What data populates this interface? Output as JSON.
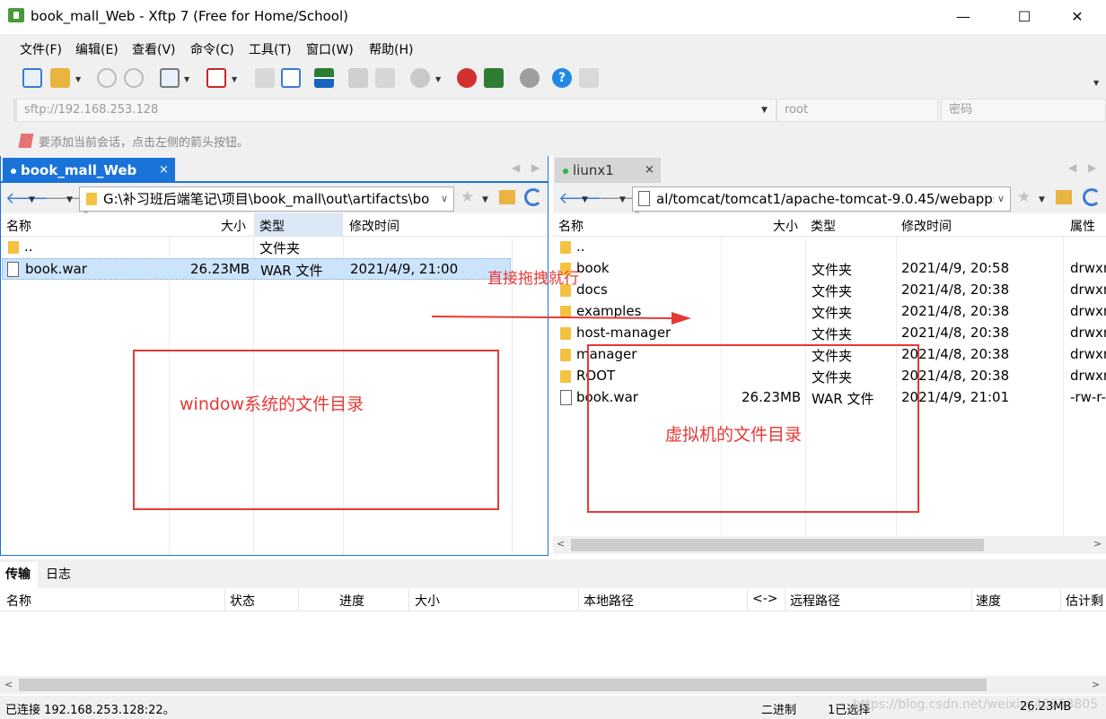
{
  "window": {
    "title": "book_mall_Web - Xftp 7 (Free for Home/School)",
    "minimize": "—",
    "maximize": "☐",
    "close": "✕"
  },
  "menu": [
    "文件(F)",
    "编辑(E)",
    "查看(V)",
    "命令(C)",
    "工具(T)",
    "窗口(W)",
    "帮助(H)"
  ],
  "address": {
    "host": "sftp://192.168.253.128",
    "user": "root",
    "password_placeholder": "密码"
  },
  "hint": "要添加当前会话，点击左侧的箭头按钮。",
  "left_pane": {
    "tab": "book_mall_Web",
    "tab_close": "×",
    "path": "G:\\补习班后端笔记\\项目\\book_mall\\out\\artifacts\\bo",
    "columns": [
      "名称",
      "大小",
      "类型",
      "修改时间"
    ],
    "rows": [
      {
        "name": "..",
        "size": "",
        "type": "文件夹",
        "modified": "",
        "icon": "folder"
      },
      {
        "name": "book.war",
        "size": "26.23MB",
        "type": "WAR 文件",
        "modified": "2021/4/9, 21:00",
        "icon": "file",
        "selected": true
      }
    ]
  },
  "right_pane": {
    "tab": "liunx1",
    "tab_close": "×",
    "path": "al/tomcat/tomcat1/apache-tomcat-9.0.45/webapps",
    "columns": [
      "名称",
      "大小",
      "类型",
      "修改时间",
      "属性"
    ],
    "rows": [
      {
        "name": "..",
        "size": "",
        "type": "",
        "modified": "",
        "attr": "",
        "icon": "folder"
      },
      {
        "name": "book",
        "size": "",
        "type": "文件夹",
        "modified": "2021/4/9, 20:58",
        "attr": "drwxr",
        "icon": "folder"
      },
      {
        "name": "docs",
        "size": "",
        "type": "文件夹",
        "modified": "2021/4/8, 20:38",
        "attr": "drwxr",
        "icon": "folder"
      },
      {
        "name": "examples",
        "size": "",
        "type": "文件夹",
        "modified": "2021/4/8, 20:38",
        "attr": "drwxr",
        "icon": "folder"
      },
      {
        "name": "host-manager",
        "size": "",
        "type": "文件夹",
        "modified": "2021/4/8, 20:38",
        "attr": "drwxr",
        "icon": "folder"
      },
      {
        "name": "manager",
        "size": "",
        "type": "文件夹",
        "modified": "2021/4/8, 20:38",
        "attr": "drwxr",
        "icon": "folder"
      },
      {
        "name": "ROOT",
        "size": "",
        "type": "文件夹",
        "modified": "2021/4/8, 20:38",
        "attr": "drwxr",
        "icon": "folder"
      },
      {
        "name": "book.war",
        "size": "26.23MB",
        "type": "WAR 文件",
        "modified": "2021/4/9, 21:01",
        "attr": "-rw-r-",
        "icon": "file"
      }
    ]
  },
  "annotations": {
    "drag_hint": "直接拖拽就行",
    "left_box": "window系统的文件目录",
    "right_box": "虚拟机的文件目录"
  },
  "bottom": {
    "tabs": [
      "传输",
      "日志"
    ],
    "columns": [
      "名称",
      "状态",
      "进度",
      "大小",
      "本地路径",
      "<->",
      "远程路径",
      "速度",
      "估计剩"
    ]
  },
  "status": {
    "connection": "已连接 192.168.253.128:22。",
    "mode": "二进制",
    "selected": "1已选择",
    "size": "26.23MB",
    "watermark": "https://blog.csdn.net/weixin_46233805"
  },
  "colors": {
    "accent": "#1a73d9",
    "annotation": "#e53935",
    "folder": "#f3c240"
  }
}
